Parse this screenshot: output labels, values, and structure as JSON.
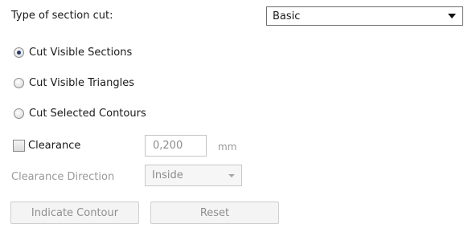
{
  "section_cut": {
    "type_label": "Type of section cut:",
    "type_value": "Basic"
  },
  "cut_options": [
    {
      "label": "Cut Visible Sections",
      "selected": true
    },
    {
      "label": "Cut Visible Triangles",
      "selected": false
    },
    {
      "label": "Cut Selected Contours",
      "selected": false
    }
  ],
  "clearance": {
    "checkbox_label": "Clearance",
    "checked": false,
    "value": "0,200",
    "unit": "mm",
    "direction_label": "Clearance Direction",
    "direction_value": "Inside"
  },
  "buttons": {
    "indicate_contour": "Indicate Contour",
    "reset": "Reset"
  },
  "icons": [
    "chevron-down-icon",
    "radio-icon",
    "checkbox-icon"
  ]
}
